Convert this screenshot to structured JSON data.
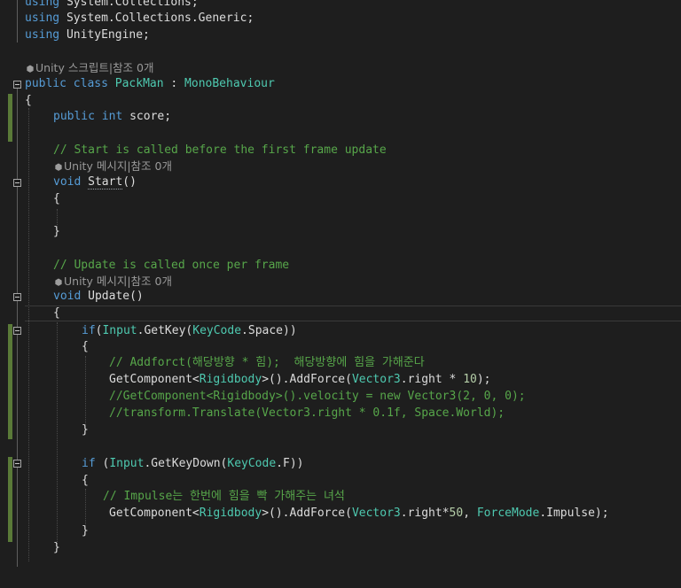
{
  "editor": {
    "lines": {
      "using1_kw": "using",
      "using1_rest": " System.Collections;",
      "using2_kw": "using",
      "using2_rest": " System.Collections.Generic;",
      "using3_kw": "using",
      "using3_rest": " UnityEngine;",
      "lens_class": "Unity 스크립트|참조 0개",
      "class_kw1": "public",
      "class_kw2": "class",
      "class_name": "PackMan",
      "class_colon": " : ",
      "class_base": "MonoBehaviour",
      "brace_open": "{",
      "brace_close": "}",
      "field_kw1": "public",
      "field_kw2": "int",
      "field_name": " score;",
      "comment_start": "// Start is called before the first frame update",
      "lens_start": "Unity 메시지|참조 0개",
      "void_kw": "void",
      "start_name": "Start",
      "parens": "()",
      "comment_update": "// Update is called once per frame",
      "lens_update": "Unity 메시지|참조 0개",
      "update_name": "Update",
      "if_kw": "if",
      "if1_open": "(",
      "input_type": "Input",
      "getkey": ".GetKey(",
      "keycode_type": "KeyCode",
      "space": ".Space))",
      "comment_addforce": "// Addforct(해당방향 * 힘);  해당방향에 힘을 가해준다",
      "getcomp": "GetComponent<",
      "rigidbody": "Rigidbody",
      "addforce": ">().AddForce(",
      "vector3": "Vector3",
      "right_mul": ".right * ",
      "ten": "10",
      "close_semi": ");",
      "comment_velocity": "//GetComponent<Rigidbody>().velocity = new Vector3(2, 0, 0);",
      "comment_translate": "//transform.Translate(Vector3.right * 0.1f, Space.World);",
      "if2_open": " (",
      "getkeydown": ".GetKeyDown(",
      "keyf": ".F))",
      "comment_impulse": "// Impulse는 한번에 힘을 빡 가해주는 녀석",
      "right_mul2": ".right*",
      "fifty": "50",
      "comma": ", ",
      "forcemode": "ForceMode",
      "impulse": ".Impulse);"
    }
  },
  "icons": [
    "unity-lens-icon",
    "fold-toggle-icon"
  ],
  "colors": {
    "background": "#1e1e1e",
    "keyword": "#569cd6",
    "type": "#4ec9b0",
    "comment": "#57a64a",
    "number": "#b5cea8",
    "text": "#dcdcdc",
    "change_bar": "#5a7a38"
  }
}
